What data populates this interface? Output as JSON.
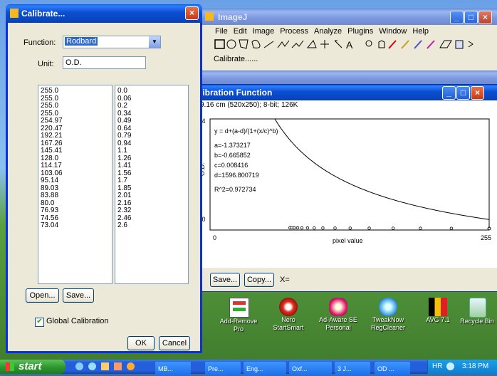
{
  "calibrate": {
    "title": "Calibrate...",
    "function_label": "Function:",
    "function_value": "Rodbard",
    "unit_label": "Unit:",
    "unit_value": "O.D.",
    "left_values": [
      "255.0",
      "255.0",
      "255.0",
      "255.0",
      "254.97",
      "220.47",
      "192.21",
      "167.26",
      "145.41",
      "128.0",
      "114.17",
      "103.06",
      "95.14",
      "89.03",
      "83.88",
      "80.0",
      "76.93",
      "74.56",
      "73.04"
    ],
    "right_values": [
      "0.0",
      "0.06",
      "0.2",
      "0.34",
      "0.49",
      "0.64",
      "0.79",
      "0.94",
      "1.1",
      "1.26",
      "1.41",
      "1.56",
      "1.7",
      "1.85",
      "2.01",
      "2.16",
      "2.32",
      "2.46",
      "2.6"
    ],
    "open_label": "Open...",
    "save_label": "Save...",
    "global_label": "Global Calibration",
    "ok_label": "OK",
    "cancel_label": "Cancel"
  },
  "imagej": {
    "title": "ImageJ",
    "menu": [
      "File",
      "Edit",
      "Image",
      "Process",
      "Analyze",
      "Plugins",
      "Window",
      "Help"
    ],
    "status": "Calibrate......"
  },
  "plot": {
    "title": "libration Function",
    "info": "9.16 cm (520x250); 8-bit; 126K",
    "equation": "y = d+(a-d)/(1+(x/c)^b)",
    "a": "a=-1.373217",
    "b": "b=-0.665852",
    "c": "c=0.008416",
    "d": "d=1596.800719",
    "r2": "R^2=0.972734",
    "y_top": ".4",
    "y_bottom": ".0",
    "y_label": "O.D.",
    "x_min": "0",
    "x_max": "255",
    "x_label": "pixel value",
    "save_label": "Save...",
    "copy_label": "Copy...",
    "x_readout": "X="
  },
  "chart_data": {
    "type": "scatter",
    "xlabel": "pixel value",
    "ylabel": "O.D.",
    "xlim": [
      0,
      255
    ],
    "points": [
      [
        73.04,
        2.6
      ],
      [
        74.56,
        2.46
      ],
      [
        76.93,
        2.32
      ],
      [
        80.0,
        2.16
      ],
      [
        83.88,
        2.01
      ],
      [
        89.03,
        1.85
      ],
      [
        95.14,
        1.7
      ],
      [
        103.06,
        1.56
      ],
      [
        114.17,
        1.41
      ],
      [
        128.0,
        1.26
      ],
      [
        145.41,
        1.1
      ],
      [
        167.26,
        0.94
      ],
      [
        192.21,
        0.79
      ],
      [
        220.47,
        0.64
      ],
      [
        254.97,
        0.49
      ],
      [
        255.0,
        0.34
      ],
      [
        255.0,
        0.2
      ],
      [
        255.0,
        0.06
      ],
      [
        255.0,
        0.0
      ]
    ]
  },
  "desktop_icons": [
    {
      "name": "add-remove-programs-icon",
      "label": "Add-Remove\nPro"
    },
    {
      "name": "nero-startsmart-icon",
      "label": "Nero\nStartSmart"
    },
    {
      "name": "adaware-icon",
      "label": "Ad-Aware SE\nPersonal"
    },
    {
      "name": "tweaknow-icon",
      "label": "TweakNow\nRegCleaner"
    },
    {
      "name": "avg-icon",
      "label": "AVG 7.1"
    },
    {
      "name": "recycle-bin-icon",
      "label": "Recycle Bin"
    }
  ],
  "taskbar": {
    "start": "start",
    "items": [
      "MB...",
      "Pre...",
      "Eng...",
      "Oxf...",
      "3 J...",
      "OD ..."
    ],
    "lang": "HR",
    "clock": "3:18 PM"
  }
}
